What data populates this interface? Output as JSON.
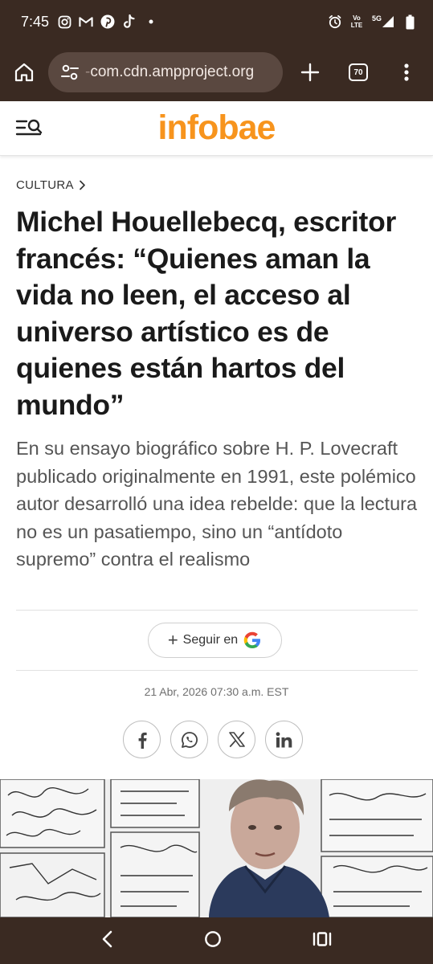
{
  "status_bar": {
    "time": "7:45",
    "network": "5G",
    "volte": "Vo LTE"
  },
  "browser": {
    "url_prefix": "-",
    "url": "com.cdn.ampproject.org",
    "tab_count": "70"
  },
  "site": {
    "logo": "infobae",
    "logo_color": "#f7941d"
  },
  "article": {
    "section": "CULTURA",
    "headline": "Michel Houellebecq, escritor francés: “Quienes aman la vida no leen, el acceso al universo artístico es de quienes están hartos del mundo”",
    "subheadline": "En su ensayo biográfico sobre H. P. Lovecraft publicado originalmente en 1991, este polémico autor desarrolló una idea rebelde: que la lectura no es un pasatiempo, sino un “antídoto supremo” contra el realismo",
    "follow_label": "Seguir en",
    "date": "21 Abr, 2026 07:30 a.m. EST"
  },
  "share": {
    "icons": [
      "facebook-icon",
      "whatsapp-icon",
      "x-icon",
      "linkedin-icon"
    ]
  },
  "nav": {
    "icons": [
      "back-icon",
      "home-icon",
      "recents-icon"
    ]
  }
}
